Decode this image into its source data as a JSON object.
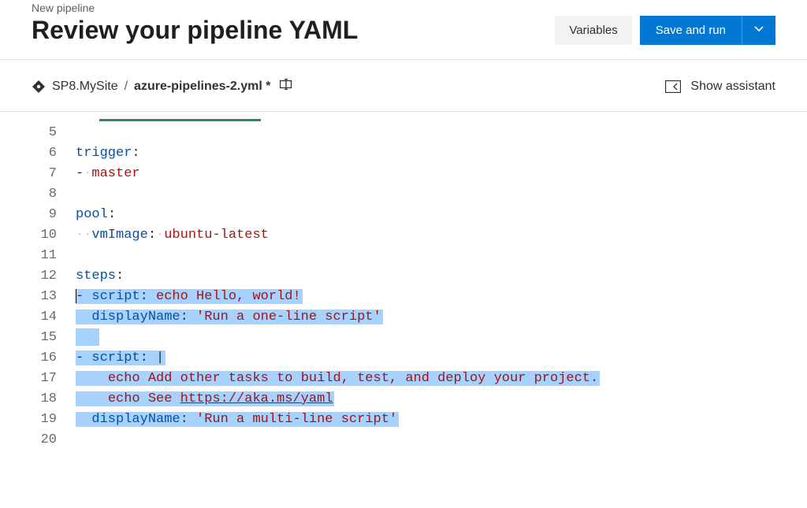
{
  "header": {
    "breadcrumb": "New pipeline",
    "title": "Review your pipeline YAML",
    "variables_label": "Variables",
    "save_run_label": "Save and run"
  },
  "subheader": {
    "repo_name": "SP8.MySite",
    "path_separator": "/",
    "filename": "azure-pipelines-2.yml *",
    "show_assistant_label": "Show assistant"
  },
  "editor": {
    "lines": [
      {
        "num": "5",
        "content": ""
      },
      {
        "num": "6",
        "tokens": [
          [
            "key",
            "trigger"
          ],
          [
            "plain",
            ":"
          ]
        ]
      },
      {
        "num": "7",
        "tokens": [
          [
            "plain",
            "-"
          ],
          [
            "ws",
            "·"
          ],
          [
            "str",
            "master"
          ]
        ]
      },
      {
        "num": "8",
        "content": ""
      },
      {
        "num": "9",
        "tokens": [
          [
            "key",
            "pool"
          ],
          [
            "plain",
            ":"
          ]
        ]
      },
      {
        "num": "10",
        "tokens": [
          [
            "ws",
            "··"
          ],
          [
            "key",
            "vmImage"
          ],
          [
            "plain",
            ":"
          ],
          [
            "ws",
            "·"
          ],
          [
            "str",
            "ubuntu-latest"
          ]
        ]
      },
      {
        "num": "11",
        "content": ""
      },
      {
        "num": "12",
        "tokens": [
          [
            "key",
            "steps"
          ],
          [
            "plain",
            ":"
          ]
        ]
      },
      {
        "num": "13",
        "selected": true,
        "tokens": [
          [
            "plain",
            "-"
          ],
          [
            "ws",
            "·"
          ],
          [
            "key",
            "script"
          ],
          [
            "plain",
            ":"
          ],
          [
            "ws",
            "·"
          ],
          [
            "str",
            "echo"
          ],
          [
            "ws",
            "·"
          ],
          [
            "str",
            "Hello,"
          ],
          [
            "ws",
            "·"
          ],
          [
            "str",
            "world!"
          ]
        ]
      },
      {
        "num": "14",
        "selected": true,
        "tokens": [
          [
            "ws",
            "··"
          ],
          [
            "key",
            "displayName"
          ],
          [
            "plain",
            ":"
          ],
          [
            "ws",
            "·"
          ],
          [
            "str",
            "'Run"
          ],
          [
            "ws",
            "·"
          ],
          [
            "str",
            "a"
          ],
          [
            "ws",
            "·"
          ],
          [
            "str",
            "one-line"
          ],
          [
            "ws",
            "·"
          ],
          [
            "str",
            "script'"
          ]
        ]
      },
      {
        "num": "15",
        "selected": true,
        "tokens": []
      },
      {
        "num": "16",
        "selected": true,
        "tokens": [
          [
            "plain",
            "-"
          ],
          [
            "ws",
            "·"
          ],
          [
            "key",
            "script"
          ],
          [
            "plain",
            ":"
          ],
          [
            "ws",
            "·"
          ],
          [
            "plain",
            "|"
          ]
        ]
      },
      {
        "num": "17",
        "selected": true,
        "tokens": [
          [
            "ws",
            "····"
          ],
          [
            "str",
            "echo"
          ],
          [
            "ws",
            "·"
          ],
          [
            "str",
            "Add"
          ],
          [
            "ws",
            "·"
          ],
          [
            "str",
            "other"
          ],
          [
            "ws",
            "·"
          ],
          [
            "str",
            "tasks"
          ],
          [
            "ws",
            "·"
          ],
          [
            "str",
            "to"
          ],
          [
            "ws",
            "·"
          ],
          [
            "str",
            "build,"
          ],
          [
            "ws",
            "·"
          ],
          [
            "str",
            "test,"
          ],
          [
            "ws",
            "·"
          ],
          [
            "str",
            "and"
          ],
          [
            "ws",
            "·"
          ],
          [
            "str",
            "deploy"
          ],
          [
            "ws",
            "·"
          ],
          [
            "str",
            "your"
          ],
          [
            "ws",
            "·"
          ],
          [
            "str",
            "project."
          ]
        ]
      },
      {
        "num": "18",
        "selected": true,
        "tokens": [
          [
            "ws",
            "····"
          ],
          [
            "str",
            "echo"
          ],
          [
            "ws",
            "·"
          ],
          [
            "str",
            "See"
          ],
          [
            "ws",
            "·"
          ],
          [
            "link",
            "https://aka.ms/yaml"
          ]
        ]
      },
      {
        "num": "19",
        "selected": true,
        "tokens": [
          [
            "ws",
            "··"
          ],
          [
            "key",
            "displayName"
          ],
          [
            "plain",
            ":"
          ],
          [
            "ws",
            "·"
          ],
          [
            "str",
            "'Run"
          ],
          [
            "ws",
            "·"
          ],
          [
            "str",
            "a"
          ],
          [
            "ws",
            "·"
          ],
          [
            "str",
            "multi-line"
          ],
          [
            "ws",
            "·"
          ],
          [
            "str",
            "script'"
          ]
        ]
      },
      {
        "num": "20",
        "content": ""
      }
    ]
  }
}
